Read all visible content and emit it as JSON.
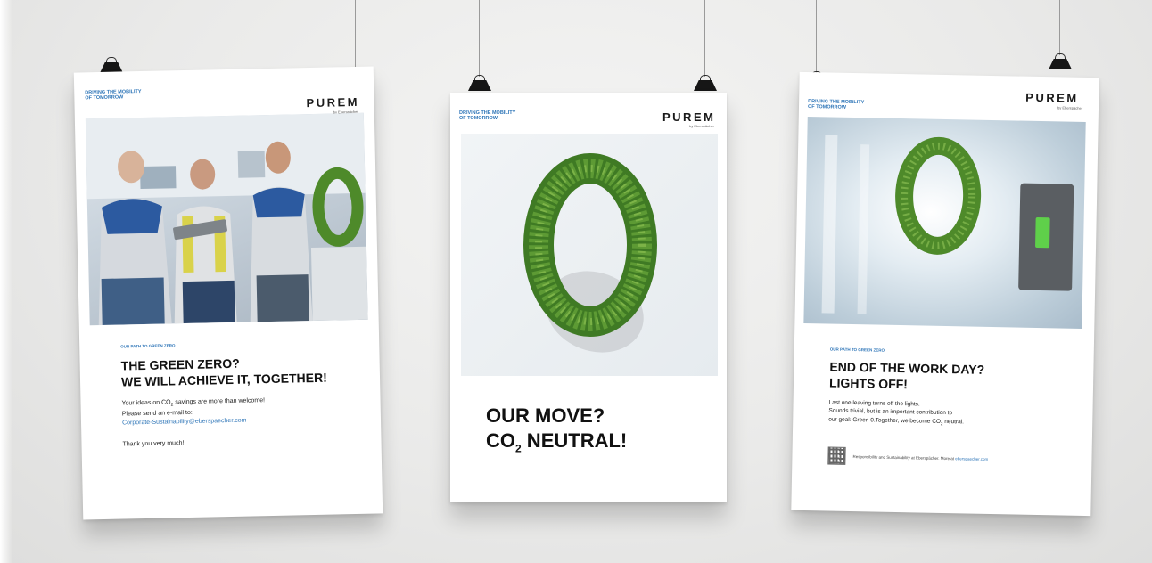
{
  "posters": [
    {
      "tagline": "Driving the mobility of tomorrow",
      "logo": "PUREM",
      "logo_sub": "by Eberspächer",
      "kicker": "Our path to green zero",
      "headline": [
        "THE GREEN ZERO?",
        "WE WILL ACHIEVE IT, TOGETHER!"
      ],
      "body": [
        "Your ideas on CO",
        "2",
        " savings are more than welcome!"
      ],
      "body_line2": "Please send an e-mail to:",
      "email": "Corporate-Sustainability@eberspaecher.com",
      "thanks": "Thank you very much!"
    },
    {
      "tagline": "Driving the mobility of tomorrow",
      "logo": "PUREM",
      "logo_sub": "by Eberspächer",
      "headline_line1": "OUR MOVE?",
      "headline_co": "CO",
      "headline_sub": "2",
      "headline_rest": " NEUTRAL!"
    },
    {
      "tagline": "Driving the mobility of tomorrow",
      "logo": "PUREM",
      "logo_sub": "by Eberspächer",
      "kicker": "Our path to green zero",
      "headline": [
        "END OF THE WORK DAY?",
        "LIGHTS OFF!"
      ],
      "body_line1": "Last one leaving turns off the lights.",
      "body_line2": "Sounds trivial, but is an important contribution to",
      "body_line3_a": "our goal: Green 0.Together, we become CO",
      "body_line3_sub": "2",
      "body_line3_b": " neutral.",
      "footer_note": "Responsibility and Sustainability at Eberspächer. More at",
      "footer_link": "eberspaecher.com"
    }
  ],
  "colors": {
    "brand_blue": "#2f76b8",
    "wall": "#eaeae9",
    "moss_green": "#4e8a2a"
  },
  "icons": [
    "binder-clip-icon",
    "qr-code-icon"
  ]
}
